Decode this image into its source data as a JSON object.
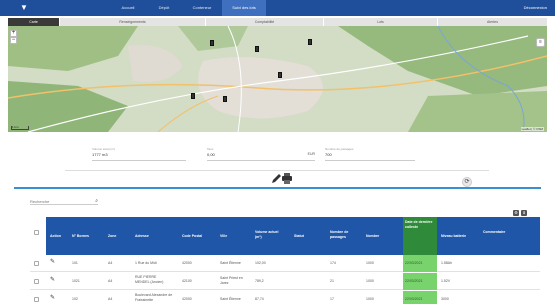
{
  "header": {
    "nav": [
      "Accueil",
      "Dépôt",
      "Conteneur",
      "Suivi des lots"
    ],
    "active_nav": "Suivi des lots",
    "logout_label": "Déconnexion"
  },
  "subtabs": [
    "Carte",
    "Renseignements",
    "Comptabilité",
    "Lots",
    "Alertes"
  ],
  "active_subtab": "Carte",
  "map": {
    "zoom_in": "+",
    "zoom_out": "−",
    "scale_label": "1 km",
    "attribution": "Leaflet | © OSM"
  },
  "fields": [
    {
      "label": "Volume total (m³)",
      "value": "1777 m3",
      "unit": ""
    },
    {
      "label": "Taux",
      "value": "0,00",
      "unit": "EUR"
    },
    {
      "label": "Nombre de passages",
      "value": "700",
      "unit": ""
    }
  ],
  "search": {
    "placeholder": "Recherche"
  },
  "table": {
    "headers": [
      "Action",
      "N° Bornes",
      "Zone",
      "Adresse",
      "Code Postal",
      "Ville",
      "Volume actuel (m³)",
      "Statut",
      "Nombre de passages",
      "Nombre",
      "Date de dernière collecte",
      "Niveau batterie",
      "Commentaire"
    ],
    "rows": [
      {
        "num": "101",
        "zone": "A4",
        "adresse": "1 Rue du Midi",
        "cp": "42000",
        "ville": "Saint Étienne",
        "volume": "102,00",
        "statut": "",
        "passages": "174",
        "nombre": "1000",
        "date": "22/03/2021",
        "batterie": "1.58Ah",
        "comment": ""
      },
      {
        "num": "1021",
        "zone": "A4",
        "adresse": "RUE PIERRE MENDEL (Ancien)",
        "cp": "42100",
        "ville": "Saint Priest en Jarez",
        "volume": "789,2",
        "statut": "",
        "passages": "21",
        "nombre": "1000",
        "date": "22/03/2021",
        "batterie": "1.52V",
        "comment": ""
      },
      {
        "num": "102",
        "zone": "A4",
        "adresse": "Boulevard Alexandre de Fraissinette",
        "cp": "42000",
        "ville": "Saint Étienne",
        "volume": "87,74",
        "statut": "",
        "passages": "17",
        "nombre": "1000",
        "date": "22/03/2021",
        "batterie": "3000",
        "comment": ""
      }
    ]
  },
  "colors": {
    "primary": "#1f4f9a",
    "accent": "#3a8fd0",
    "success": "#78d36d"
  }
}
